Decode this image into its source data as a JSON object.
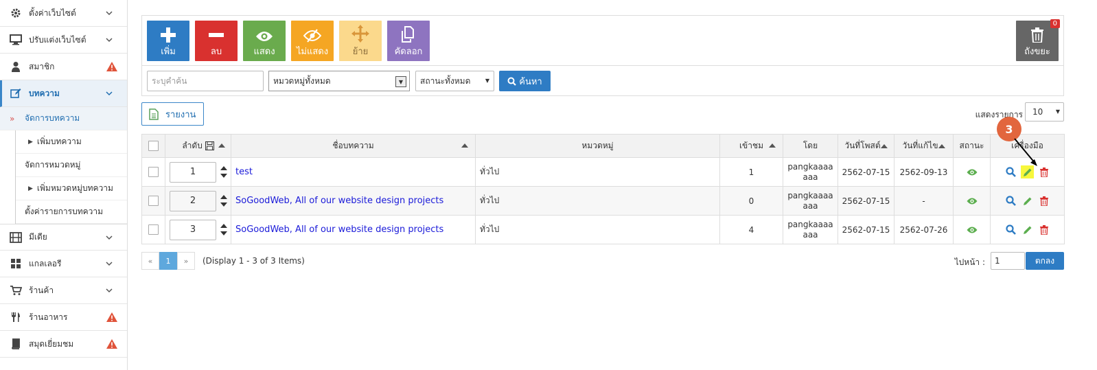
{
  "sidebar": {
    "items": [
      {
        "label": "ตั้งค่าเว็บไซต์",
        "icon": "gear-icon"
      },
      {
        "label": "ปรับแต่งเว็บไซต์",
        "icon": "monitor-icon"
      },
      {
        "label": "สมาชิก",
        "icon": "user-icon"
      },
      {
        "label": "บทความ",
        "icon": "edit-icon"
      },
      {
        "label": "มีเดีย",
        "icon": "film-icon"
      },
      {
        "label": "แกลเลอรี",
        "icon": "grid-icon"
      },
      {
        "label": "ร้านค้า",
        "icon": "cart-icon"
      },
      {
        "label": "ร้านอาหาร",
        "icon": "cutlery-icon"
      },
      {
        "label": "สมุดเยี่ยมชม",
        "icon": "book-icon"
      }
    ],
    "sub": {
      "manage_articles": "จัดการบทความ",
      "add_article": "เพิ่มบทความ",
      "manage_categories": "จัดการหมวดหมู่",
      "add_category": "เพิ่มหมวดหมู่บทความ",
      "article_settings": "ตั้งค่ารายการบทความ"
    }
  },
  "toolbar": {
    "add": "เพิ่ม",
    "delete": "ลบ",
    "show": "แสดง",
    "hide": "ไม่แสดง",
    "move": "ย้าย",
    "copy": "คัดลอก",
    "trash": "ถังขยะ",
    "trash_count": "0"
  },
  "filter": {
    "search_placeholder": "ระบุคำค้น",
    "category": "หมวดหมู่ทั้งหมด",
    "status": "สถานะทั้งหมด",
    "search_button": "ค้นหา"
  },
  "report_button": "รายงาน",
  "show_items_label": "แสดงรายการ",
  "show_items_value": "10",
  "table": {
    "headers": {
      "order": "ลำดับ",
      "title": "ชื่อบทความ",
      "category": "หมวดหมู่",
      "views": "เข้าชม",
      "by": "โดย",
      "posted": "วันที่โพสต์",
      "edited": "วันที่แก้ไข",
      "status": "สถานะ",
      "tools": "เครื่องมือ"
    },
    "rows": [
      {
        "order": "1",
        "title": "test",
        "category": "ทั่วไป",
        "views": "1",
        "by": "pangkaaaaaaa",
        "posted": "2562-07-15",
        "edited": "2562-09-13"
      },
      {
        "order": "2",
        "title": "SoGoodWeb, All of our website design projects",
        "category": "ทั่วไป",
        "views": "0",
        "by": "pangkaaaaaaa",
        "posted": "2562-07-15",
        "edited": "-"
      },
      {
        "order": "3",
        "title": "SoGoodWeb, All of our website design projects",
        "category": "ทั่วไป",
        "views": "4",
        "by": "pangkaaaaaaa",
        "posted": "2562-07-15",
        "edited": "2562-07-26"
      }
    ]
  },
  "pager": {
    "prev": "«",
    "current": "1",
    "next": "»",
    "display": "(Display 1 - 3 of 3 Items)",
    "goto_label": "ไปหน้า :",
    "goto_value": "1",
    "ok": "ตกลง"
  },
  "callout": "3",
  "colors": {
    "accent": "#2e7cc4",
    "danger": "#d9312f",
    "callout": "#e2663e",
    "highlight": "#f7f73c"
  }
}
